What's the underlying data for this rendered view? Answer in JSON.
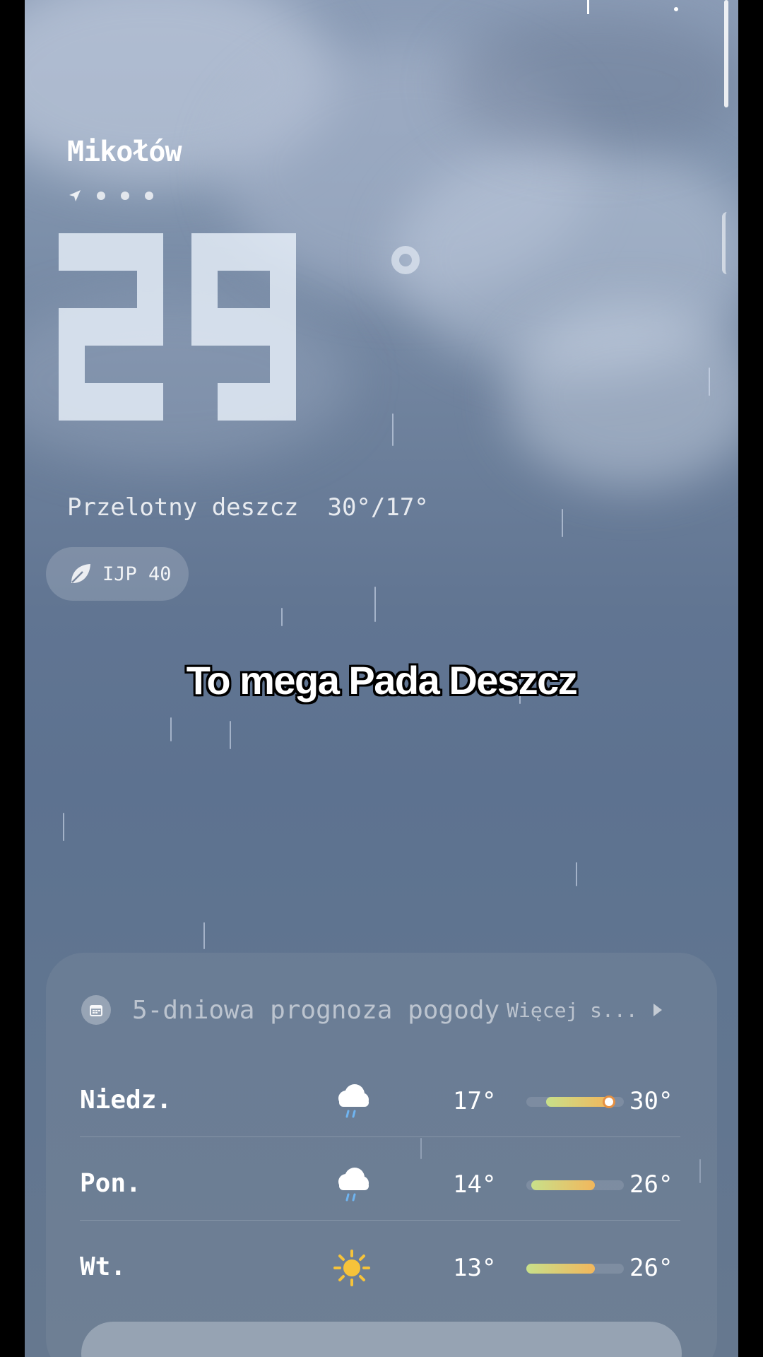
{
  "location": {
    "city": "Mikołów"
  },
  "current": {
    "temperature": 29,
    "condition": "Przelotny deszcz",
    "high_low": "30°/17°",
    "aqi_label": "IJP 40"
  },
  "caption": "To mega Pada Deszcz",
  "forecast": {
    "title": "5-dniowa prognoza pogody",
    "more_label": "Więcej s...",
    "days": [
      {
        "day": "Niedz.",
        "icon": "rain-cloud-icon",
        "low": "17°",
        "high": "30°",
        "range_start": 0.2,
        "range_end": 0.85,
        "current_marker": 0.85
      },
      {
        "day": "Pon.",
        "icon": "rain-cloud-icon",
        "low": "14°",
        "high": "26°",
        "range_start": 0.05,
        "range_end": 0.7
      },
      {
        "day": "Wt.",
        "icon": "sun-icon",
        "low": "13°",
        "high": "26°",
        "range_start": 0.0,
        "range_end": 0.7
      }
    ]
  },
  "colors": {
    "bar_start": "#c8e08a",
    "bar_end": "#f2b75c",
    "sun": "#f6c33a",
    "rain_drop": "#6fb4f0"
  }
}
